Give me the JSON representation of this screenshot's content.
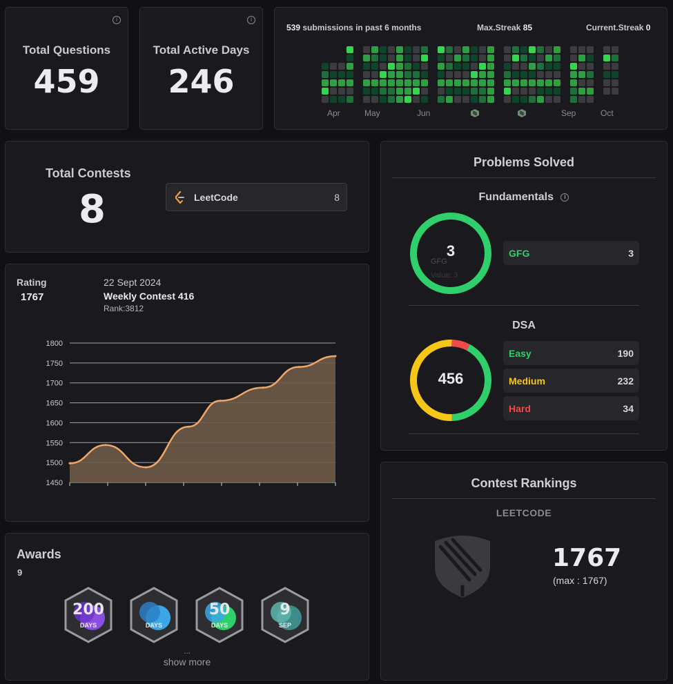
{
  "stats": {
    "total_questions_label": "Total Questions",
    "total_questions": "459",
    "total_active_days_label": "Total Active Days",
    "total_active_days": "246",
    "info_glyph": "i"
  },
  "heatmap": {
    "submissions": "539",
    "submissions_text": "submissions in past 6 months",
    "max_streak_label": "Max.Streak",
    "max_streak": "85",
    "current_streak_label": "Current.Streak",
    "current_streak": "0",
    "months": [
      "Apr",
      "May",
      "Jun",
      "Sep",
      "Oct"
    ],
    "badge_icons": [
      "leetcode-badge-icon",
      "leetcode-badge-icon"
    ],
    "colors": {
      "empty": "#3b3b40",
      "low": "#0e4429",
      "mid": "#1f6f3b",
      "high": "#2ea043",
      "max": "#39d353"
    }
  },
  "contests": {
    "label": "Total Contests",
    "value": "8",
    "platform": "LeetCode",
    "platform_count": "8",
    "platform_icon": "leetcode-logo-icon"
  },
  "rating": {
    "label": "Rating",
    "value": "1767",
    "date": "22 Sept 2024",
    "contest": "Weekly Contest 416",
    "rank": "Rank:3812"
  },
  "chart_data": {
    "type": "area",
    "x": [
      1,
      2,
      3,
      4,
      5,
      6,
      7,
      8,
      9
    ],
    "values": [
      1498,
      1544,
      1488,
      1590,
      1655,
      1688,
      1740,
      1767
    ],
    "series": [
      {
        "values": [
          1498,
          1544,
          1488,
          1590,
          1655,
          1688,
          1740,
          1767
        ]
      }
    ],
    "yticks": [
      "1800",
      "1750",
      "1700",
      "1650",
      "1600",
      "1550",
      "1500",
      "1450"
    ],
    "ylim": [
      1450,
      1800
    ],
    "xlabel": "",
    "ylabel": "",
    "title": "",
    "grid": true,
    "line_color": "#f0a868",
    "fill_color": "#6e5a48"
  },
  "awards": {
    "label": "Awards",
    "count": "9",
    "ellipsis": "...",
    "show_more": "show more",
    "badges": [
      {
        "icon": "200-days-badge-icon",
        "big": "200",
        "text": "DAYS"
      },
      {
        "icon": "100-days-badge-icon",
        "big": "",
        "text": "DAYS"
      },
      {
        "icon": "50-days-badge-icon",
        "big": "50",
        "text": "DAYS"
      },
      {
        "icon": "sep-badge-icon",
        "big": "9",
        "text": "SEP"
      }
    ]
  },
  "problems": {
    "title": "Problems Solved",
    "fundamentals_label": "Fundamentals",
    "fundamentals_total": "3",
    "ghost_label": "GFG",
    "ghost_value": "Value: 3",
    "gfg_label": "GFG",
    "gfg_value": "3",
    "dsa_label": "DSA",
    "dsa_total": "456",
    "easy_label": "Easy",
    "easy_value": "190",
    "medium_label": "Medium",
    "medium_value": "232",
    "hard_label": "Hard",
    "hard_value": "34",
    "colors": {
      "easy": "#2fd06b",
      "medium": "#f5c518",
      "hard": "#ef4b4b"
    }
  },
  "rankings": {
    "title": "Contest Rankings",
    "platform": "LEETCODE",
    "rating": "1767",
    "max": "(max : 1767)",
    "badge_icon": "knight-shield-icon"
  }
}
